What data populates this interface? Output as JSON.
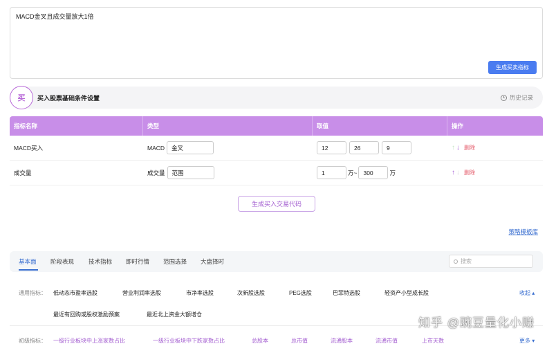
{
  "prompt": {
    "text": "MACD金叉且成交量放大1倍",
    "generate_label": "生成买卖指标"
  },
  "section": {
    "badge": "买",
    "title": "买入股票基础条件设置",
    "history_label": "历史记录"
  },
  "table": {
    "headers": [
      "指标名称",
      "类型",
      "取值",
      "操作"
    ],
    "rows": [
      {
        "name": "MACD买入",
        "type_label": "MACD",
        "type_value": "金叉",
        "values": [
          "12",
          "26",
          "9"
        ],
        "delete": "删除"
      },
      {
        "name": "成交量",
        "type_label": "成交量",
        "type_value": "范围",
        "value_min": "1",
        "unit_mid": "万~",
        "value_max": "300",
        "unit_end": "万",
        "delete": "删除"
      }
    ]
  },
  "generate_code_label": "生成买入交易代码",
  "strategy_link": "策略模板库",
  "tabs": [
    "基本面",
    "阶段表现",
    "技术指标",
    "即时行情",
    "范围选择",
    "大盘择时"
  ],
  "search_placeholder": "搜索",
  "common": {
    "label": "通用指标：",
    "items": [
      "低动态市盈率选股",
      "营业利润率选股",
      "市净率选股",
      "次新股选股",
      "PEG选股",
      "巴菲特选股",
      "轻资产小型成长股",
      "最近有回购或股权激励预案",
      "最近北上资金大额增仓"
    ],
    "collapse": "收起"
  },
  "advanced": {
    "label": "初级指标：",
    "items": [
      "一级行业板块中上涨家数占比",
      "一级行业板块中下跌家数占比",
      "总股本",
      "总市值",
      "流通股本",
      "流通市值",
      "上市天数"
    ],
    "more": "更多"
  },
  "watermark": "知乎 @豌豆量化小赚",
  "colors": {
    "accent_purple": "#c88ee8",
    "primary_blue": "#4a7cf0",
    "delete_red": "#e45a6a"
  }
}
